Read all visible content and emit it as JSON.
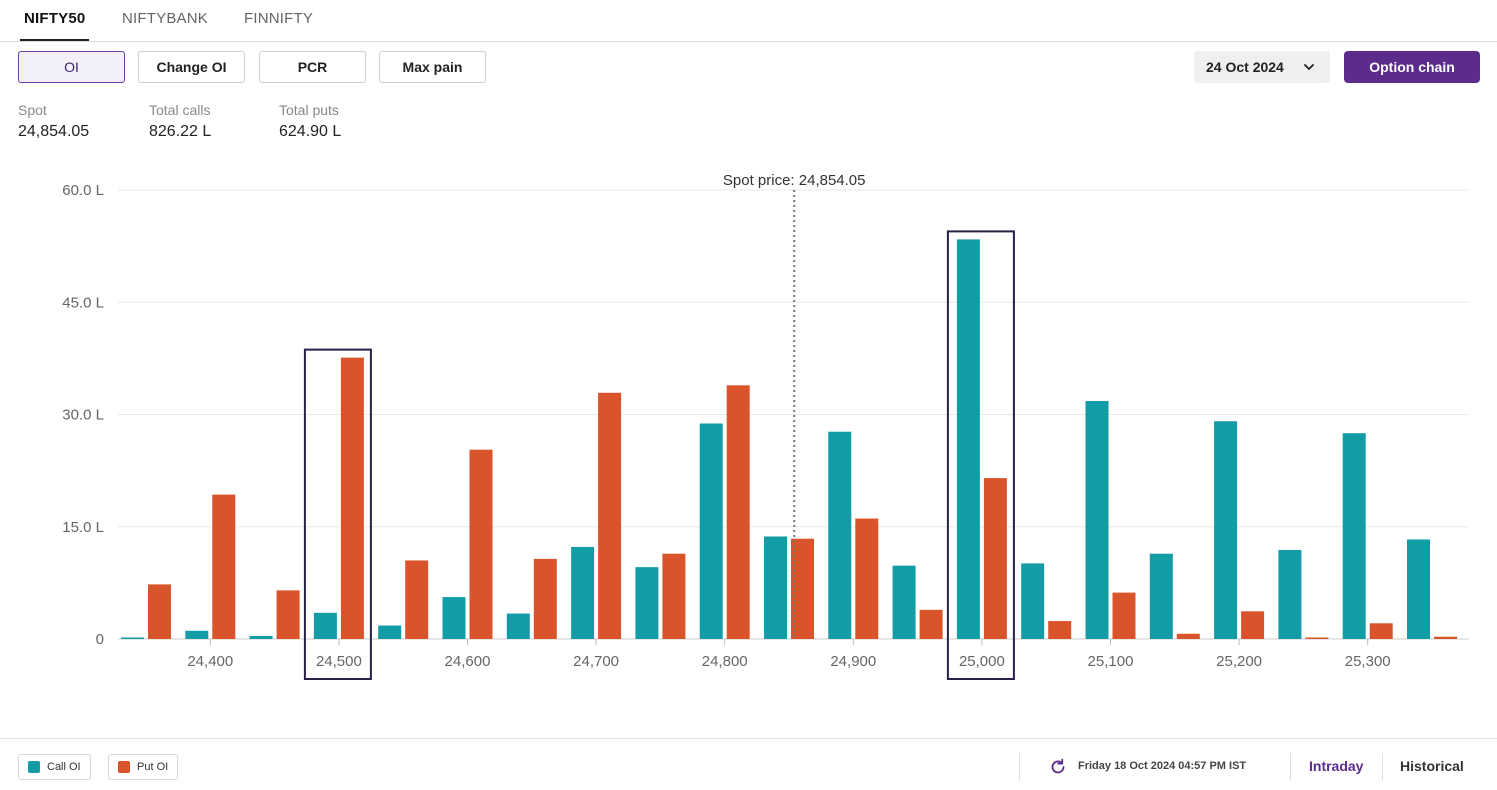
{
  "tabs": [
    {
      "label": "NIFTY50",
      "active": true
    },
    {
      "label": "NIFTYBANK",
      "active": false
    },
    {
      "label": "FINNIFTY",
      "active": false
    }
  ],
  "toolbar": {
    "buttons": [
      {
        "label": "OI",
        "active": true
      },
      {
        "label": "Change OI",
        "active": false
      },
      {
        "label": "PCR",
        "active": false
      },
      {
        "label": "Max pain",
        "active": false
      }
    ],
    "date_select": {
      "value": "24 Oct 2024",
      "icon": "chevron-down-icon"
    },
    "option_chain_label": "Option chain"
  },
  "stats": [
    {
      "label": "Spot",
      "value": "24,854.05"
    },
    {
      "label": "Total calls",
      "value": "826.22 L"
    },
    {
      "label": "Total puts",
      "value": "624.90 L"
    }
  ],
  "chart_data": {
    "type": "bar",
    "categories": [
      24350,
      24400,
      24450,
      24500,
      24550,
      24600,
      24650,
      24700,
      24750,
      24800,
      24850,
      24900,
      24950,
      25000,
      25050,
      25100,
      25150,
      25200,
      25250,
      25300,
      25350
    ],
    "x_tick_labels": [
      "24,400",
      "24,500",
      "24,600",
      "24,700",
      "24,800",
      "24,900",
      "25,000",
      "25,100",
      "25,200",
      "25,300"
    ],
    "x_tick_values": [
      24400,
      24500,
      24600,
      24700,
      24800,
      24900,
      25000,
      25100,
      25200,
      25300
    ],
    "y_tick_labels": [
      "0",
      "15.0 L",
      "30.0 L",
      "45.0 L",
      "60.0 L"
    ],
    "y_tick_values": [
      0,
      15,
      30,
      45,
      60
    ],
    "ylim": [
      0,
      60
    ],
    "series": [
      {
        "name": "Call OI",
        "color": "#119ca6",
        "values": [
          0.2,
          1.1,
          0.4,
          3.5,
          1.8,
          5.6,
          3.4,
          12.3,
          9.6,
          28.8,
          13.7,
          27.7,
          9.8,
          53.4,
          10.1,
          31.8,
          11.4,
          29.1,
          11.9,
          27.5,
          13.3
        ]
      },
      {
        "name": "Put OI",
        "color": "#d9542b",
        "values": [
          7.3,
          19.3,
          6.5,
          37.6,
          10.5,
          25.3,
          10.7,
          32.9,
          11.4,
          33.9,
          13.4,
          16.1,
          3.9,
          21.5,
          2.4,
          6.2,
          0.7,
          3.7,
          0.2,
          2.1,
          0.3
        ]
      }
    ],
    "spot_price_value": 24854.05,
    "spot_price_label": "Spot price: 24,854.05",
    "highlighted_strikes": [
      24500,
      25000
    ],
    "grid": true
  },
  "footer": {
    "legend": [
      {
        "label": "Call OI",
        "color": "#119ca6"
      },
      {
        "label": "Put OI",
        "color": "#d9542b"
      }
    ],
    "timestamp": "Friday 18 Oct 2024 04:57 PM IST",
    "intraday_label": "Intraday",
    "historical_label": "Historical"
  }
}
